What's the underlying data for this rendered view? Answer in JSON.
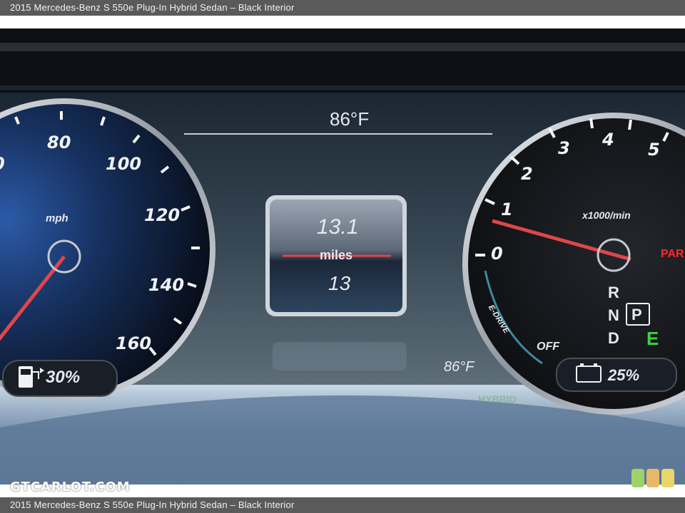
{
  "caption": {
    "top": "2015 Mercedes-Benz S 550e Plug-In Hybrid Sedan – Black Interior",
    "bottom": "2015 Mercedes-Benz S 550e Plug-In Hybrid Sedan – Black Interior"
  },
  "cluster": {
    "temperature_top": "86°F",
    "temperature_bottom": "86°F",
    "center_display": {
      "value": "13.1",
      "unit": "miles",
      "secondary": "13"
    },
    "speedometer": {
      "unit": "mph",
      "ticks": [
        "0",
        "80",
        "100",
        "120",
        "140",
        "160"
      ],
      "fuel_percent": "30%"
    },
    "power_meter": {
      "unit": "x1000/min",
      "ticks": [
        "0",
        "1",
        "2",
        "3",
        "4",
        "5"
      ],
      "edrive_label": "E-DRIVE",
      "off_label": "OFF",
      "battery_percent": "25%",
      "gear_letters": [
        "R",
        "N",
        "D"
      ],
      "selected_gear": "P",
      "drive_mode": "E",
      "park_label": "PAR",
      "hybrid_label": "HYBRID"
    }
  },
  "watermark": "GTCARLOT.COM",
  "colors": {
    "needle": "#e0464a",
    "park": "#ff2a2a",
    "drive_mode": "#3ed23e",
    "logo": [
      "#9fd36a",
      "#e8b86a",
      "#e8d66a"
    ]
  }
}
